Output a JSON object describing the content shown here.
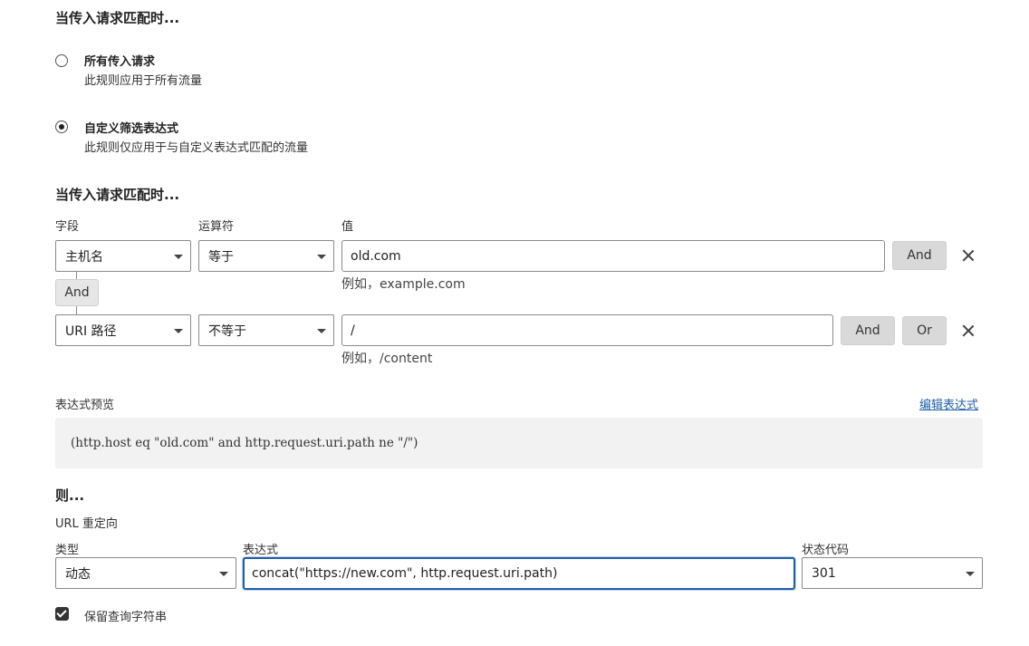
{
  "match": {
    "title": "当传入请求匹配时...",
    "options": [
      {
        "label": "所有传入请求",
        "desc": "此规则应用于所有流量",
        "checked": false
      },
      {
        "label": "自定义筛选表达式",
        "desc": "此规则仅应用于与自定义表达式匹配的流量",
        "checked": true
      }
    ]
  },
  "builder": {
    "title": "当传入请求匹配时...",
    "col_field": "字段",
    "col_operator": "运算符",
    "col_value": "值",
    "rows": [
      {
        "field": "主机名",
        "operator": "等于",
        "value": "old.com",
        "hint": "例如，example.com",
        "and_label": "And"
      },
      {
        "field": "URI 路径",
        "operator": "不等于",
        "value": "/",
        "hint": "例如，/content",
        "and_label": "And",
        "or_label": "Or"
      }
    ],
    "connector_label": "And"
  },
  "preview": {
    "label": "表达式预览",
    "edit_link": "编辑表达式",
    "expression": "(http.host eq \"old.com\" and http.request.uri.path ne \"/\")"
  },
  "then": {
    "title": "则...",
    "action": "URL 重定向",
    "type_label": "类型",
    "type_value": "动态",
    "expr_label": "表达式",
    "expr_value": "concat(\"https://new.com\", http.request.uri.path)",
    "status_label": "状态代码",
    "status_value": "301",
    "preserve_label": "保留查询字符串",
    "preserve_checked": true
  }
}
